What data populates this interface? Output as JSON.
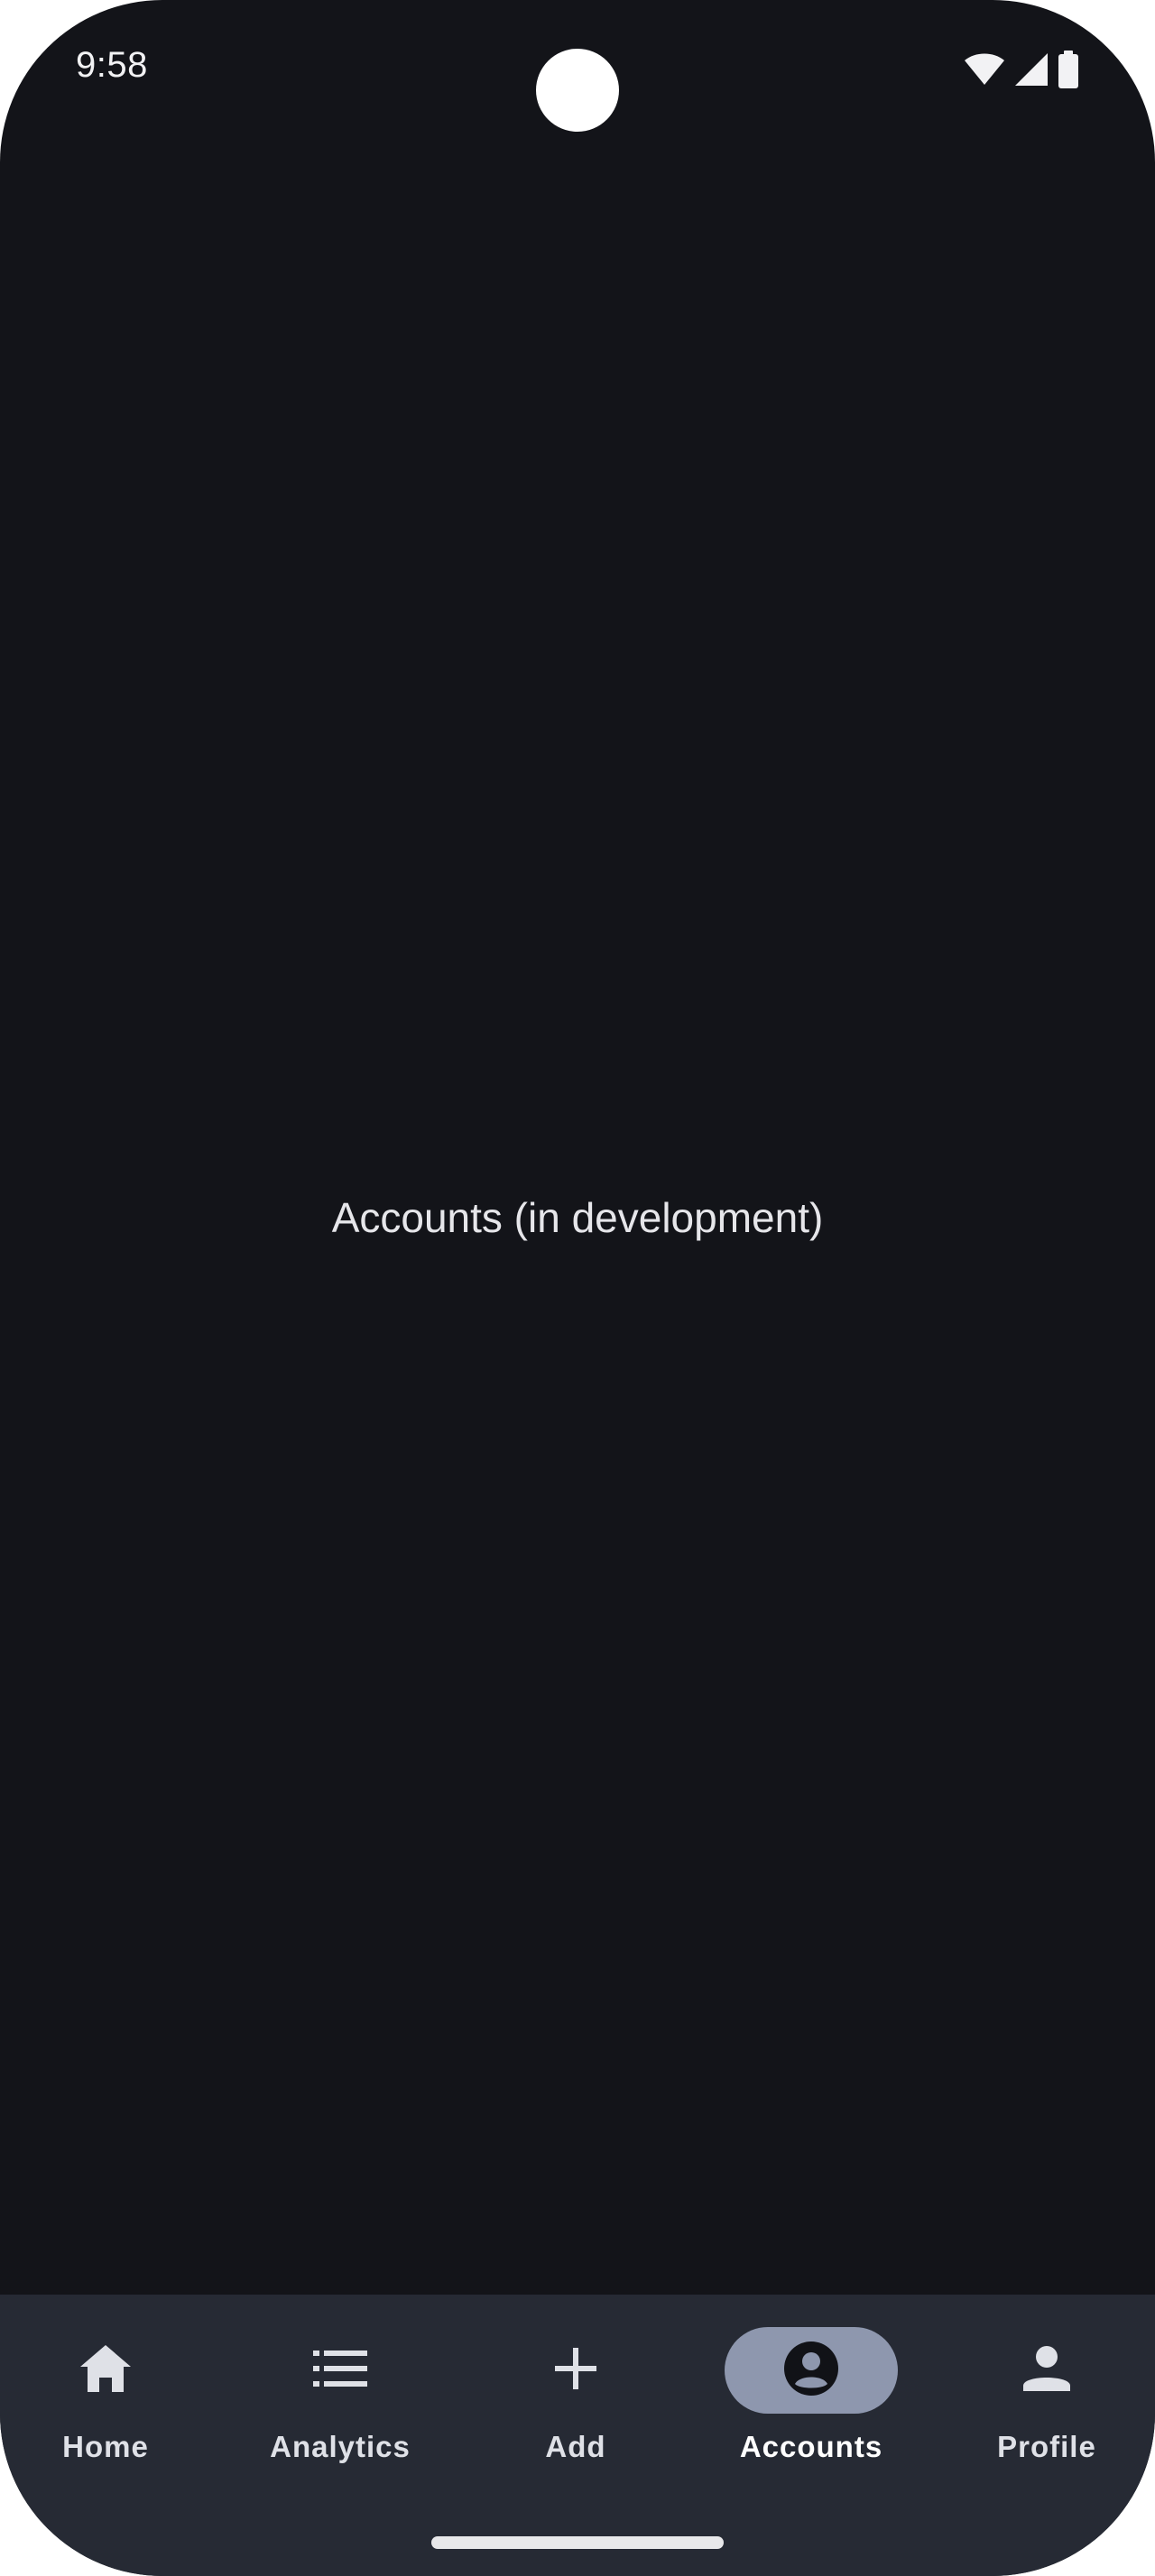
{
  "status_bar": {
    "time": "9:58",
    "icons": [
      "wifi-icon",
      "cellular-signal-icon",
      "battery-icon"
    ]
  },
  "main": {
    "placeholder": "Accounts (in development)"
  },
  "bottom_nav": {
    "items": [
      {
        "label": "Home",
        "icon": "home-icon",
        "active": false
      },
      {
        "label": "Analytics",
        "icon": "list-icon",
        "active": false
      },
      {
        "label": "Add",
        "icon": "plus-icon",
        "active": false
      },
      {
        "label": "Accounts",
        "icon": "account-circle-icon",
        "active": true
      },
      {
        "label": "Profile",
        "icon": "person-icon",
        "active": false
      }
    ]
  },
  "colors": {
    "background": "#131419",
    "nav_background": "#262a34",
    "active_pill": "#8e97ae",
    "text": "#e6e6ea"
  }
}
